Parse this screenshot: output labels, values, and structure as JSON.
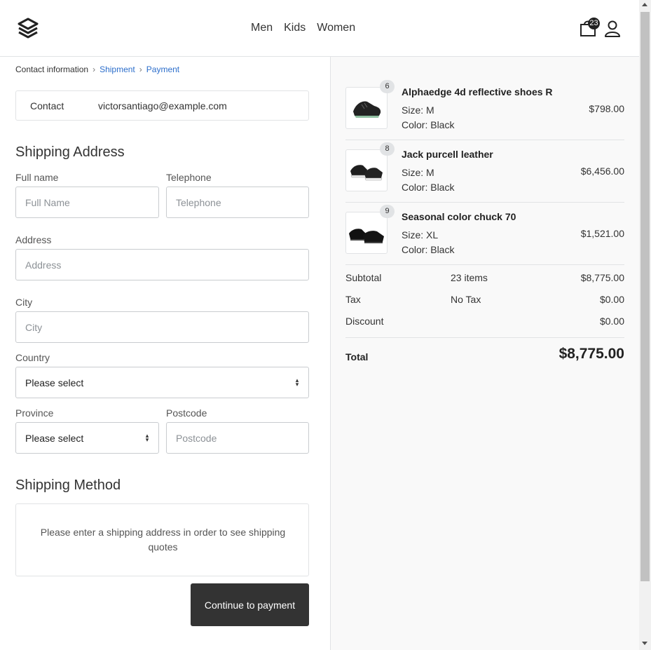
{
  "header": {
    "logo_icon": "layers-logo-icon",
    "nav": [
      "Men",
      "Kids",
      "Women"
    ],
    "cart_count": "23",
    "cart_icon": "shopping-bag-icon",
    "user_icon": "user-icon"
  },
  "breadcrumb": {
    "items": [
      "Contact information",
      "Shipment",
      "Payment"
    ],
    "separator": "›"
  },
  "contact": {
    "label": "Contact",
    "email": "victorsantiago@example.com"
  },
  "shipping_address": {
    "title": "Shipping Address",
    "full_name": {
      "label": "Full name",
      "placeholder": "Full Name",
      "value": ""
    },
    "telephone": {
      "label": "Telephone",
      "placeholder": "Telephone",
      "value": ""
    },
    "address": {
      "label": "Address",
      "placeholder": "Address",
      "value": ""
    },
    "city": {
      "label": "City",
      "placeholder": "City",
      "value": ""
    },
    "country": {
      "label": "Country",
      "selected": "Please select"
    },
    "province": {
      "label": "Province",
      "selected": "Please select"
    },
    "postcode": {
      "label": "Postcode",
      "placeholder": "Postcode",
      "value": ""
    }
  },
  "shipping_method": {
    "title": "Shipping Method",
    "message": "Please enter a shipping address in order to see shipping quotes"
  },
  "continue_button": "Continue to payment",
  "cart_items": [
    {
      "qty": "6",
      "name": "Alphaedge 4d reflective shoes R",
      "size": "Size: M",
      "color": "Color: Black",
      "price": "$798.00"
    },
    {
      "qty": "8",
      "name": "Jack purcell leather",
      "size": "Size: M",
      "color": "Color: Black",
      "price": "$6,456.00"
    },
    {
      "qty": "9",
      "name": "Seasonal color chuck 70",
      "size": "Size: XL",
      "color": "Color: Black",
      "price": "$1,521.00"
    }
  ],
  "totals": {
    "subtotal": {
      "label": "Subtotal",
      "note": "23 items",
      "value": "$8,775.00"
    },
    "tax": {
      "label": "Tax",
      "note": "No Tax",
      "value": "$0.00"
    },
    "discount": {
      "label": "Discount",
      "value": "$0.00"
    },
    "total": {
      "label": "Total",
      "value": "$8,775.00"
    }
  },
  "colors": {
    "primary_button": "#333333",
    "link": "#2c6ecb",
    "summary_bg": "#f9f9f9",
    "border": "#e1e3e5"
  }
}
